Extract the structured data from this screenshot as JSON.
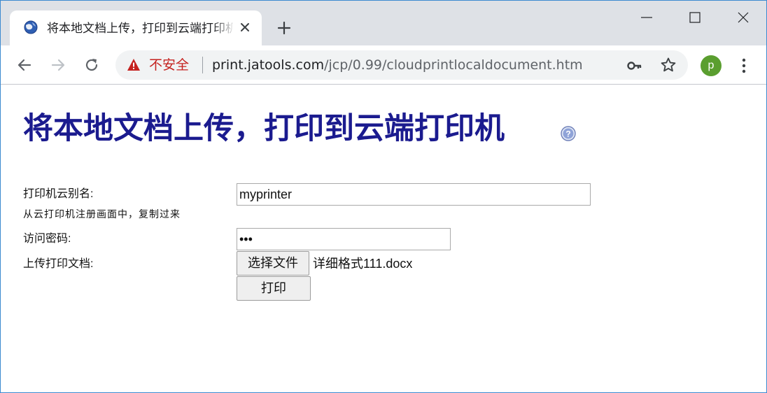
{
  "browser": {
    "tab_title": "将本地文档上传，打印到云端打印机",
    "tab_close_icon": "close-icon",
    "new_tab_icon": "plus-icon",
    "not_secure_label": "不安全",
    "url_host": "print.jatools.com",
    "url_path": "/jcp/0.99/cloudprintlocaldocument.htm",
    "avatar_letter": "p",
    "avatar_color": "#5a9e2f",
    "warning_color": "#c5221f"
  },
  "page": {
    "title": "将本地文档上传，打印到云端打印机",
    "title_color": "#1b1b8f",
    "help_icon": "help-icon"
  },
  "form": {
    "printer_alias_label": "打印机云别名:",
    "printer_alias_hint": "从云打印机注册画面中，复制过来",
    "printer_alias_value": "myprinter",
    "password_label": "访问密码:",
    "password_value": "•••",
    "upload_label": "上传打印文档:",
    "choose_file_button": "选择文件",
    "chosen_file_name": "详细格式111.docx",
    "print_button": "打印"
  }
}
